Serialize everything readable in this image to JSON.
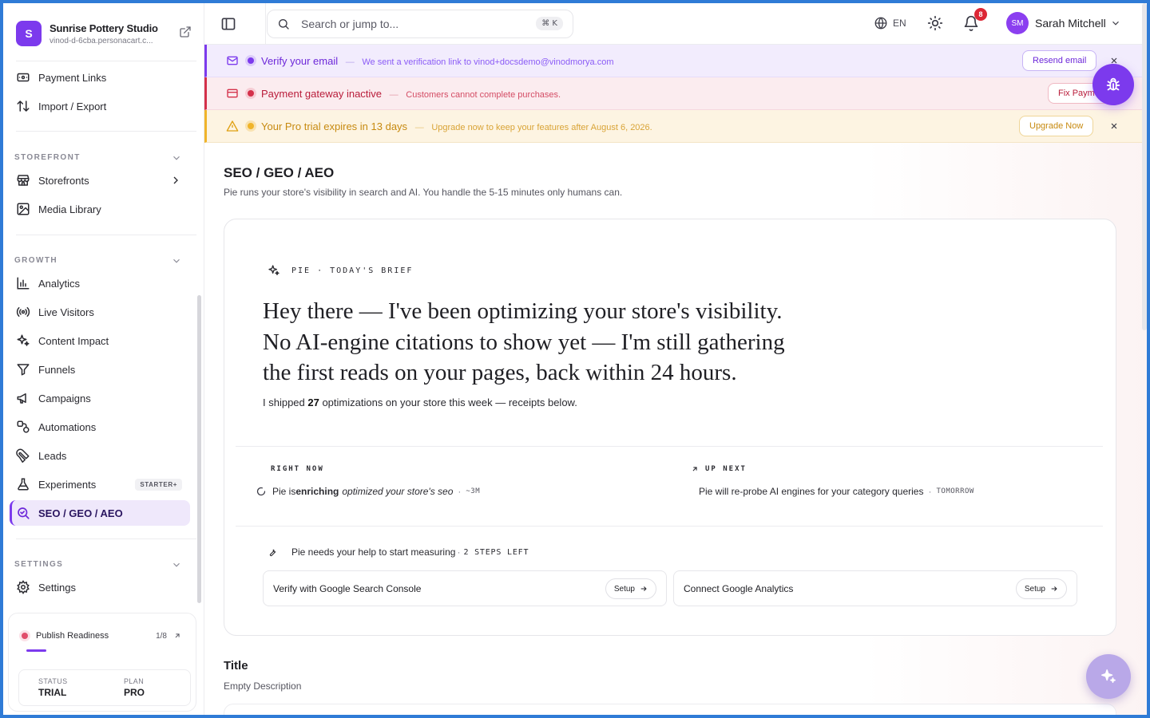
{
  "store": {
    "initial": "S",
    "name": "Sunrise Pottery Studio",
    "url": "vinod-d-6cba.personacart.c..."
  },
  "sidebar": {
    "top_items": [
      {
        "label": "Payment Links"
      },
      {
        "label": "Import / Export"
      }
    ],
    "sections": {
      "storefront": "STOREFRONT",
      "growth": "GROWTH",
      "settings": "SETTINGS"
    },
    "storefront_items": [
      {
        "label": "Storefronts"
      },
      {
        "label": "Media Library"
      }
    ],
    "growth_items": [
      {
        "label": "Analytics"
      },
      {
        "label": "Live Visitors"
      },
      {
        "label": "Content Impact"
      },
      {
        "label": "Funnels"
      },
      {
        "label": "Campaigns"
      },
      {
        "label": "Automations"
      },
      {
        "label": "Leads"
      },
      {
        "label": "Experiments",
        "badge": "STARTER+"
      },
      {
        "label": "SEO / GEO / AEO"
      }
    ],
    "settings_items": [
      {
        "label": "Settings"
      }
    ],
    "readiness": {
      "label": "Publish Readiness",
      "count": "1/8",
      "progress": 0.125,
      "status_key": "STATUS",
      "status_value": "TRIAL",
      "plan_key": "PLAN",
      "plan_value": "PRO"
    }
  },
  "topbar": {
    "search_placeholder": "Search or jump to...",
    "shortcut": "⌘ K",
    "language": "EN",
    "notifications": "8",
    "user_initials": "SM",
    "user_name": "Sarah Mitchell"
  },
  "banners": {
    "email": {
      "title": "Verify your email",
      "separator": "—",
      "message": "We sent a verification link to vinod+docsdemo@vinodmorya.com",
      "button": "Resend email"
    },
    "payment": {
      "title": "Payment gateway inactive",
      "separator": "—",
      "message": "Customers cannot complete purchases.",
      "button": "Fix Payme"
    },
    "trial": {
      "title": "Your Pro trial expires in 13 days",
      "separator": "—",
      "message": "Upgrade now to keep your features after August 6, 2026.",
      "button": "Upgrade Now"
    }
  },
  "page": {
    "title": "SEO / GEO / AEO",
    "subtitle": "Pie runs your store's visibility in search and AI. You handle the 5-15 minutes only humans can."
  },
  "brief": {
    "kicker": "PIE · TODAY'S BRIEF",
    "headline_1": "Hey there — I've been optimizing your store's visibility.",
    "headline_2": "No AI-engine citations to show yet — I'm still gathering",
    "headline_3": "the first reads on your pages, back within 24 hours.",
    "shipped_prefix": "I shipped ",
    "shipped_count": "27",
    "shipped_suffix": " optimizations on your store this week — receipts below.",
    "right_now_label": "RIGHT NOW",
    "right_now_prefix": "Pie is ",
    "right_now_bold": "enriching",
    "right_now_italic": "optimized your store's seo",
    "right_now_sep": "·",
    "right_now_tag": "~3M",
    "up_next_label": "UP NEXT",
    "up_next_text": "Pie will re-probe AI engines for your category queries",
    "up_next_sep": "·",
    "up_next_tag": "TOMORROW",
    "help_text": "Pie needs your help to start measuring",
    "help_sep": "·",
    "help_steps": "2 STEPS LEFT",
    "setup_cards": [
      {
        "label": "Verify with Google Search Console",
        "button": "Setup"
      },
      {
        "label": "Connect Google Analytics",
        "button": "Setup"
      }
    ]
  },
  "section": {
    "title": "Title",
    "description": "Empty Description"
  },
  "colors": {
    "accent": "#7c3aed",
    "danger": "#d4304a",
    "warning": "#f0b429"
  }
}
